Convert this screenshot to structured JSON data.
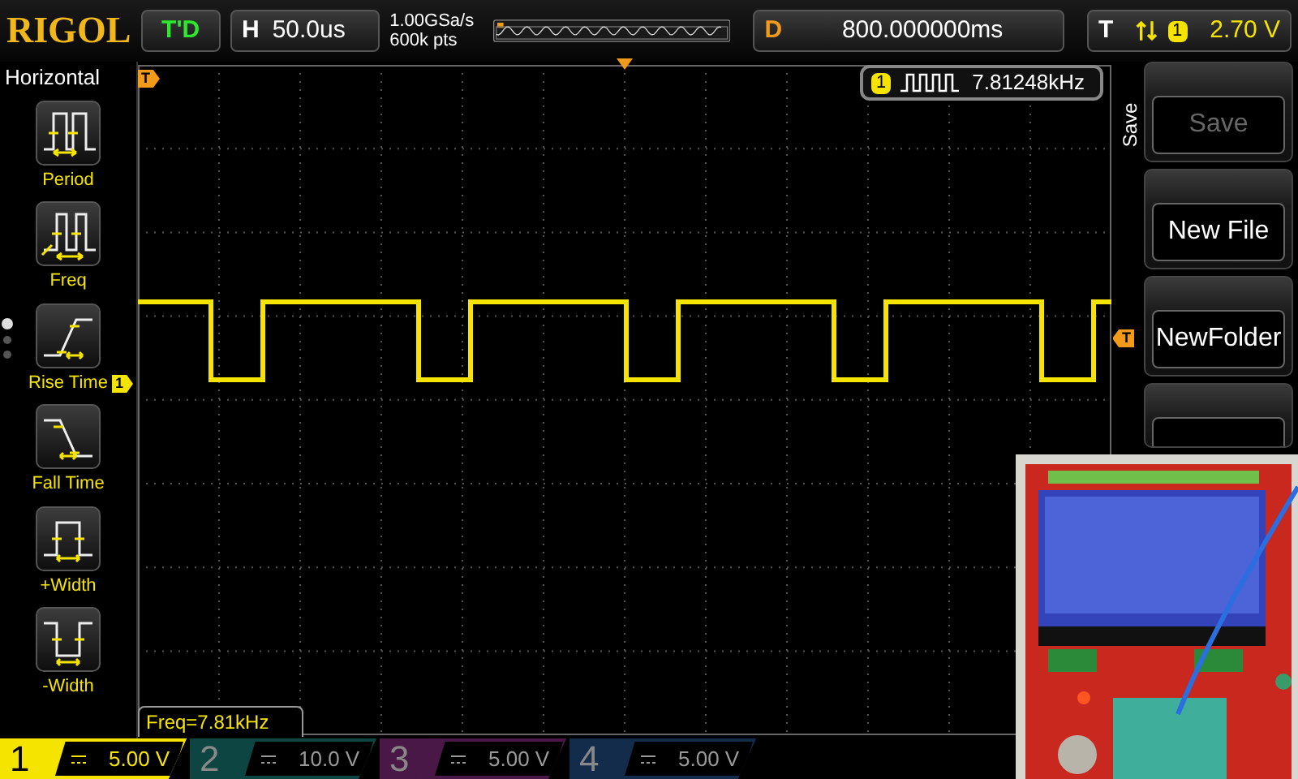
{
  "brand": "RIGOL",
  "run_status": "T'D",
  "horizontal": {
    "label": "H",
    "timebase": "50.0us",
    "sample_rate": "1.00GSa/s",
    "memory_depth": "600k pts"
  },
  "delay": {
    "label": "D",
    "value": "800.000000ms"
  },
  "trigger": {
    "label": "T",
    "source": "1",
    "level": "2.70 V"
  },
  "left_menu": {
    "title": "Horizontal",
    "items": [
      {
        "kind": "period",
        "label": "Period"
      },
      {
        "kind": "freq",
        "label": "Freq"
      },
      {
        "kind": "rise",
        "label": "Rise Time"
      },
      {
        "kind": "fall",
        "label": "Fall Time"
      },
      {
        "kind": "pwidth",
        "label": "+Width"
      },
      {
        "kind": "nwidth",
        "label": "-Width"
      }
    ],
    "pages": [
      {
        "selected": true
      },
      {
        "selected": false
      },
      {
        "selected": false
      }
    ]
  },
  "markers": {
    "trigger_position": "T",
    "channel": "1",
    "trigger_level": "T"
  },
  "measurement": {
    "channel": "1",
    "value": "7.81248kHz"
  },
  "readout": "Freq=7.81kHz",
  "right_menu": {
    "title": "Save",
    "buttons": [
      {
        "label": "Save",
        "disabled": true
      },
      {
        "label": "New File",
        "disabled": false
      },
      {
        "label": "NewFolder",
        "disabled": false
      },
      {
        "kind": "covered"
      }
    ]
  },
  "channels": [
    {
      "number": "1",
      "scale": "5.00 V",
      "selected": true,
      "color": "#f5e400"
    },
    {
      "number": "2",
      "scale": "10.0 V",
      "selected": false,
      "color": "#0d4542"
    },
    {
      "number": "3",
      "scale": "5.00 V",
      "selected": false,
      "color": "#4a1846"
    },
    {
      "number": "4",
      "scale": "5.00 V",
      "selected": false,
      "color": "#142c4c"
    }
  ]
}
